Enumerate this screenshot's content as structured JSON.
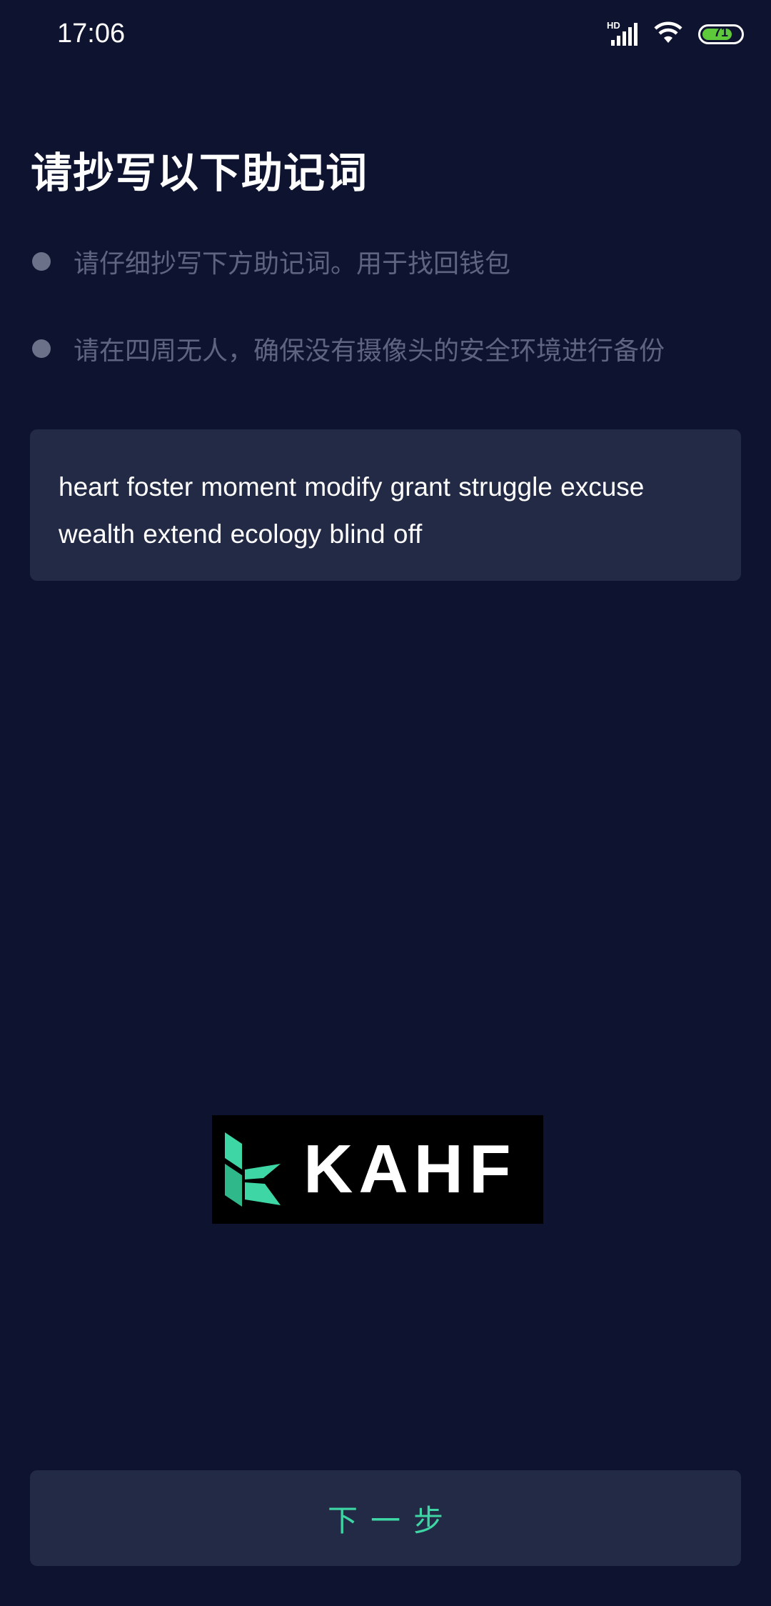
{
  "status_bar": {
    "time": "17:06",
    "network_label": "HD",
    "battery_level": "71",
    "icons": [
      "hd-signal-icon",
      "wifi-icon",
      "battery-icon"
    ]
  },
  "page": {
    "title": "请抄写以下助记词",
    "tips": [
      "请仔细抄写下方助记词。用于找回钱包",
      "请在四周无人，确保没有摄像头的安全环境进行备份"
    ],
    "mnemonic": "heart foster moment modify grant struggle excuse wealth extend ecology blind off"
  },
  "logo": {
    "text": "KAHF",
    "mark_color": "#3dd6a4"
  },
  "footer": {
    "next_label": "下一步"
  },
  "colors": {
    "background": "#0e1430",
    "card": "#232a45",
    "accent": "#3dd6a4",
    "muted_text": "#5f6580"
  }
}
